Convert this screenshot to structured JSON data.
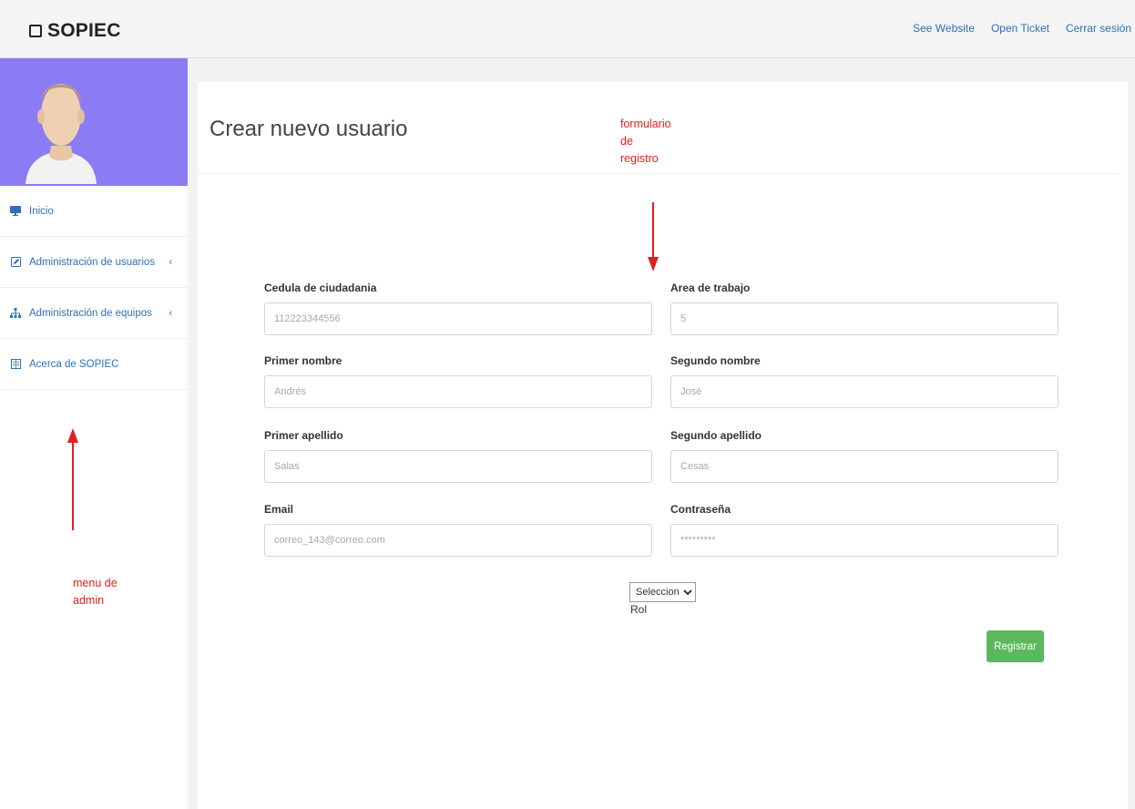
{
  "header": {
    "brand": "SOPIEC",
    "links": [
      {
        "label": "See Website"
      },
      {
        "label": "Open Ticket"
      },
      {
        "label": "Cerrar sesión"
      }
    ]
  },
  "sidebar": {
    "items": [
      {
        "label": "Inicio",
        "icon": "monitor-icon"
      },
      {
        "label": "Administración de usuarios",
        "icon": "edit-icon",
        "chevron": "‹"
      },
      {
        "label": "Administración de equipos",
        "icon": "sitemap-icon",
        "chevron": "‹"
      },
      {
        "label": "Acerca de SOPIEC",
        "icon": "book-icon"
      }
    ]
  },
  "main": {
    "title": "Crear nuevo usuario",
    "fields": {
      "cedula": {
        "label": "Cedula de ciudadania",
        "placeholder": "112223344556"
      },
      "area": {
        "label": "Area de trabajo",
        "placeholder": "5"
      },
      "primer_nombre": {
        "label": "Primer nombre",
        "placeholder": "Andrés"
      },
      "segundo_nombre": {
        "label": "Segundo nombre",
        "placeholder": "José"
      },
      "primer_apellido": {
        "label": "Primer apellido",
        "placeholder": "Salas"
      },
      "segundo_apellido": {
        "label": "Segundo apellido",
        "placeholder": "Cesas"
      },
      "email": {
        "label": "Email",
        "placeholder": "correo_143@correo.com"
      },
      "password": {
        "label": "Contraseña",
        "placeholder": "*********"
      }
    },
    "rol": {
      "selected": "Seleccionar",
      "label": "Rol"
    },
    "submit_label": "Registrar"
  },
  "annotations": {
    "form_note": [
      "formulario",
      "de",
      "registro"
    ],
    "admin_note": [
      "menu de",
      "admin"
    ],
    "color": "#e02020"
  },
  "colors": {
    "avatar_bg": "#8b7cf6",
    "link": "#2f6fb8",
    "submit": "#5cb85c"
  }
}
